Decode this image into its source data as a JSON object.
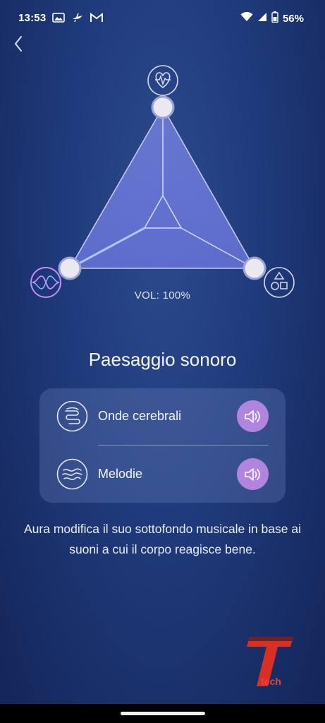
{
  "status_bar": {
    "time": "13:53",
    "left_icons": [
      "photo-icon",
      "drone-icon",
      "gmail-icon"
    ],
    "right_icons": [
      "wifi-icon",
      "signal-icon",
      "battery-icon"
    ],
    "battery": "56%"
  },
  "header": {
    "back_icon": "chevron-left-icon"
  },
  "soundscape_chart": {
    "top_icon": "heart-pulse-icon",
    "left_icon": "sound-wave-icon",
    "right_icon": "shapes-icon",
    "volume_label": "VOL: 100%"
  },
  "section": {
    "title": "Paesaggio sonoro"
  },
  "sound_card": {
    "items": [
      {
        "label": "Onde cerebrali",
        "icon": "brain-icon",
        "action_icon": "speaker-icon"
      },
      {
        "label": "Melodie",
        "icon": "waves-icon",
        "action_icon": "speaker-icon"
      }
    ]
  },
  "description": "Aura modifica il suo sottofondo musicale in base ai suoni a cui il corpo reagisce bene.",
  "watermark": {
    "logo_letter": "T",
    "text": "tech"
  },
  "colors": {
    "background": "#1f3a7a",
    "accent_purple": "#b184e0",
    "triangle_fill": "#6a75d8",
    "card_background": "#4a5d9e"
  }
}
